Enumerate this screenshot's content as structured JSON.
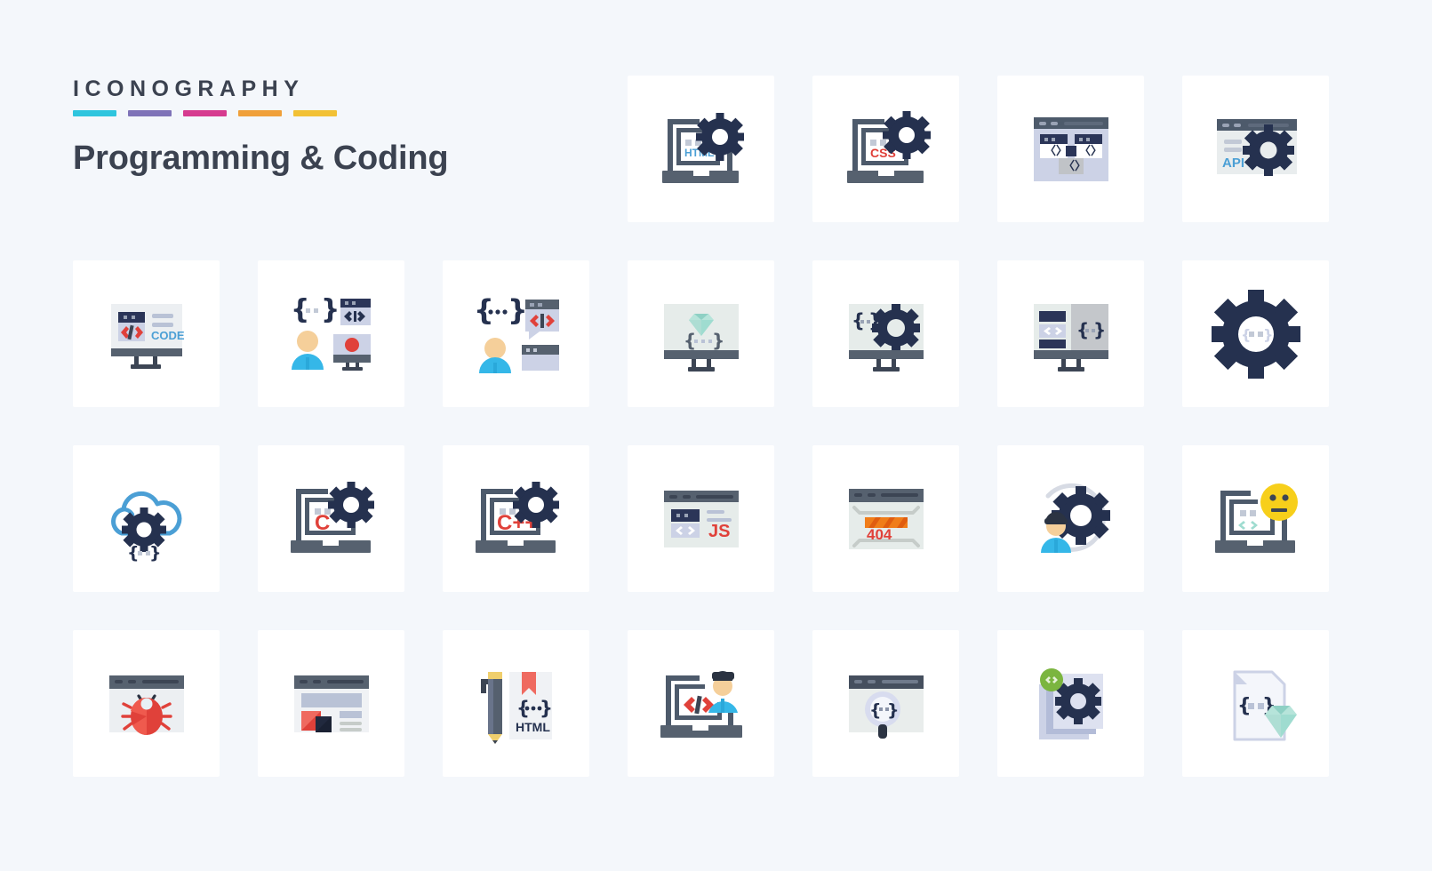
{
  "header": {
    "kicker": "ICONOGRAPHY",
    "title": "Programming & Coding",
    "accent_bars": [
      "#2ec5de",
      "#7f73b8",
      "#d63b8f",
      "#f0a03a",
      "#f2c135"
    ],
    "text_color": "#3b4250"
  },
  "palette": {
    "page_background": "#f4f7fb",
    "card_background": "#ffffff",
    "dark_navy": "#25314f",
    "slate": "#505c6e",
    "steel": "#5a6573",
    "light_panel": "#e8eef0",
    "lavender": "#c7cee8",
    "pale_lavender": "#dfe3f2",
    "red": "#e0413a",
    "blue_accent": "#4b9fd5",
    "sky": "#35b7e8",
    "yellow": "#f7cf1b",
    "skin": "#f5cf9a",
    "green": "#7bb53f",
    "mint": "#9fdcd0",
    "orange": "#f07d1a"
  },
  "grid": {
    "columns": 7,
    "rows": 4,
    "total_icons": 28,
    "visible_icon_count": 25
  },
  "icons": [
    {
      "row": 1,
      "col": 1,
      "name": "empty-slot",
      "label": "",
      "empty": true
    },
    {
      "row": 1,
      "col": 2,
      "name": "empty-slot",
      "label": "",
      "empty": true
    },
    {
      "row": 1,
      "col": 3,
      "name": "empty-slot",
      "label": "",
      "empty": true
    },
    {
      "row": 1,
      "col": 4,
      "name": "html-laptop-settings-icon",
      "label": "HTML",
      "text": "HTML"
    },
    {
      "row": 1,
      "col": 5,
      "name": "css-laptop-settings-icon",
      "label": "CSS",
      "text": "CSS"
    },
    {
      "row": 1,
      "col": 6,
      "name": "browser-code-modules-icon",
      "label": "Code Modules",
      "text": ""
    },
    {
      "row": 1,
      "col": 7,
      "name": "api-settings-browser-icon",
      "label": "API",
      "text": "API"
    },
    {
      "row": 2,
      "col": 1,
      "name": "code-monitor-icon",
      "label": "CODE",
      "text": "CODE"
    },
    {
      "row": 2,
      "col": 2,
      "name": "developer-code-monitor-icon",
      "label": "Developer",
      "text": ""
    },
    {
      "row": 2,
      "col": 3,
      "name": "developer-code-chat-icon",
      "label": "Code Chat",
      "text": ""
    },
    {
      "row": 2,
      "col": 4,
      "name": "diamond-code-monitor-icon",
      "label": "Ruby Monitor",
      "text": ""
    },
    {
      "row": 2,
      "col": 5,
      "name": "code-settings-monitor-icon",
      "label": "Code Settings",
      "text": ""
    },
    {
      "row": 2,
      "col": 6,
      "name": "split-code-monitor-icon",
      "label": "Split Code",
      "text": ""
    },
    {
      "row": 2,
      "col": 7,
      "name": "gear-code-icon",
      "label": "Gear Code",
      "text": ""
    },
    {
      "row": 3,
      "col": 1,
      "name": "cloud-code-settings-icon",
      "label": "Cloud Code",
      "text": ""
    },
    {
      "row": 3,
      "col": 2,
      "name": "c-language-laptop-icon",
      "label": "C",
      "text": "C"
    },
    {
      "row": 3,
      "col": 3,
      "name": "cpp-language-laptop-icon",
      "label": "C++",
      "text": "C++"
    },
    {
      "row": 3,
      "col": 4,
      "name": "javascript-browser-icon",
      "label": "JS",
      "text": "JS"
    },
    {
      "row": 3,
      "col": 5,
      "name": "error-404-browser-icon",
      "label": "404",
      "text": "404"
    },
    {
      "row": 3,
      "col": 6,
      "name": "developer-settings-gear-icon",
      "label": "Developer Settings",
      "text": ""
    },
    {
      "row": 3,
      "col": 7,
      "name": "neutral-emoji-laptop-code-icon",
      "label": "Neutral Code",
      "text": ""
    },
    {
      "row": 4,
      "col": 1,
      "name": "bug-browser-icon",
      "label": "Bug",
      "text": ""
    },
    {
      "row": 4,
      "col": 2,
      "name": "web-design-browser-icon",
      "label": "Web Design",
      "text": ""
    },
    {
      "row": 4,
      "col": 3,
      "name": "html-pencil-bookmark-icon",
      "label": "HTML",
      "text": "HTML"
    },
    {
      "row": 4,
      "col": 4,
      "name": "developer-laptop-code-icon",
      "label": "Developer Laptop",
      "text": ""
    },
    {
      "row": 4,
      "col": 5,
      "name": "code-search-browser-icon",
      "label": "Code Search",
      "text": ""
    },
    {
      "row": 4,
      "col": 6,
      "name": "code-files-settings-icon",
      "label": "Code Files Settings",
      "text": ""
    },
    {
      "row": 4,
      "col": 7,
      "name": "ruby-code-file-icon",
      "label": "Ruby File",
      "text": ""
    }
  ]
}
